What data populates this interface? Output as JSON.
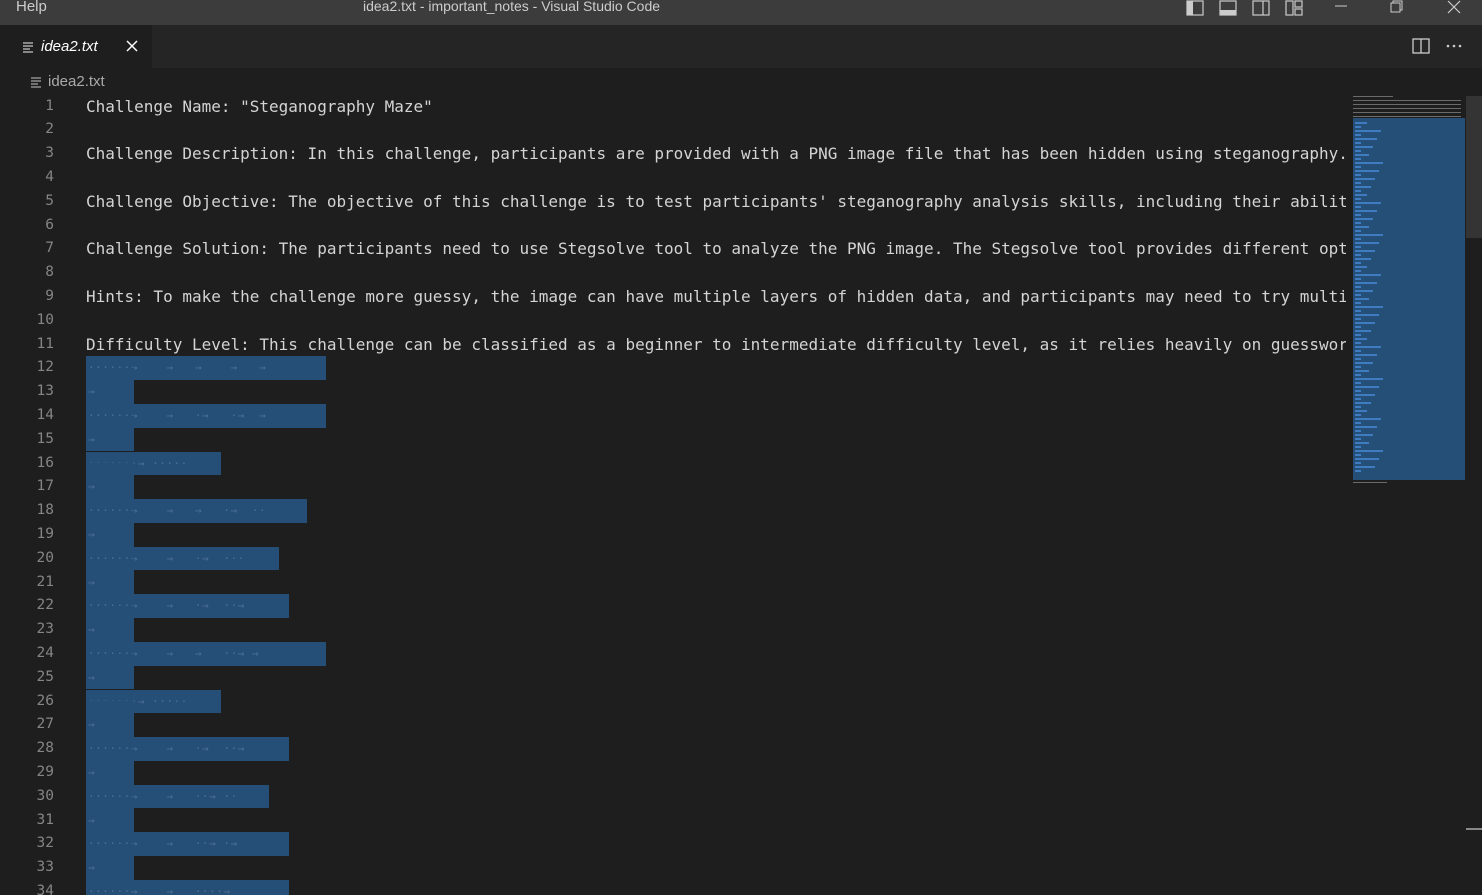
{
  "titlebar": {
    "menu_help": "Help",
    "window_title": "idea2.txt - important_notes - Visual Studio Code",
    "icons": [
      "toggle-primary-sidebar-icon",
      "toggle-panel-icon",
      "toggle-secondary-sidebar-icon",
      "customize-layout-icon",
      "minimize-icon",
      "restore-icon",
      "close-window-icon"
    ]
  },
  "tab": {
    "label": "idea2.txt",
    "icon": "file-lines-icon",
    "close_icon": "close-icon"
  },
  "editor_actions": [
    "split-editor-icon",
    "more-actions-icon"
  ],
  "breadcrumb": {
    "label": "idea2.txt",
    "icon": "file-lines-icon"
  },
  "editor": {
    "lines": [
      {
        "n": "1",
        "text": "Challenge Name: \"Steganography Maze\""
      },
      {
        "n": "2",
        "text": ""
      },
      {
        "n": "3",
        "text": "Challenge Description: In this challenge, participants are provided with a PNG image file that has been hidden using steganography."
      },
      {
        "n": "4",
        "text": ""
      },
      {
        "n": "5",
        "text": "Challenge Objective: The objective of this challenge is to test participants' steganography analysis skills, including their abilit"
      },
      {
        "n": "6",
        "text": ""
      },
      {
        "n": "7",
        "text": "Challenge Solution: The participants need to use Stegsolve tool to analyze the PNG image. The Stegsolve tool provides different opt"
      },
      {
        "n": "8",
        "text": ""
      },
      {
        "n": "9",
        "text": "Hints: To make the challenge more guessy, the image can have multiple layers of hidden data, and participants may need to try multi"
      },
      {
        "n": "10",
        "text": ""
      },
      {
        "n": "11",
        "text": "Difficulty Level: This challenge can be classified as a beginner to intermediate difficulty level, as it relies heavily on guesswor"
      },
      {
        "n": "12",
        "ws": "······→    →   →    →   →"
      },
      {
        "n": "13",
        "ws": "→"
      },
      {
        "n": "14",
        "ws": "······→    →   ·→   ·→  →"
      },
      {
        "n": "15",
        "ws": "→"
      },
      {
        "n": "16",
        "ws": "·······→ ·····"
      },
      {
        "n": "17",
        "ws": "→"
      },
      {
        "n": "18",
        "ws": "······→    →   →   ·→  ··"
      },
      {
        "n": "19",
        "ws": "→"
      },
      {
        "n": "20",
        "ws": "······→    →   ·→  ···"
      },
      {
        "n": "21",
        "ws": "→"
      },
      {
        "n": "22",
        "ws": "······→    →   ·→  ··→"
      },
      {
        "n": "23",
        "ws": "→"
      },
      {
        "n": "24",
        "ws": "······→    →   →   ··→ →"
      },
      {
        "n": "25",
        "ws": "→"
      },
      {
        "n": "26",
        "ws": "·······→ ·····"
      },
      {
        "n": "27",
        "ws": "→"
      },
      {
        "n": "28",
        "ws": "······→    →   ·→  ··→"
      },
      {
        "n": "29",
        "ws": "→"
      },
      {
        "n": "30",
        "ws": "······→    →   ··→ ··"
      },
      {
        "n": "31",
        "ws": "→"
      },
      {
        "n": "32",
        "ws": "······→    →   ··→ ·→"
      },
      {
        "n": "33",
        "ws": "→"
      },
      {
        "n": "34",
        "ws": "······→    →   ····→"
      }
    ]
  },
  "colors": {
    "titlebar_bg": "#3c3c3c",
    "editor_bg": "#1e1e1e",
    "selection": "#264f78",
    "line_number": "#858585",
    "text": "#d4d4d4"
  }
}
